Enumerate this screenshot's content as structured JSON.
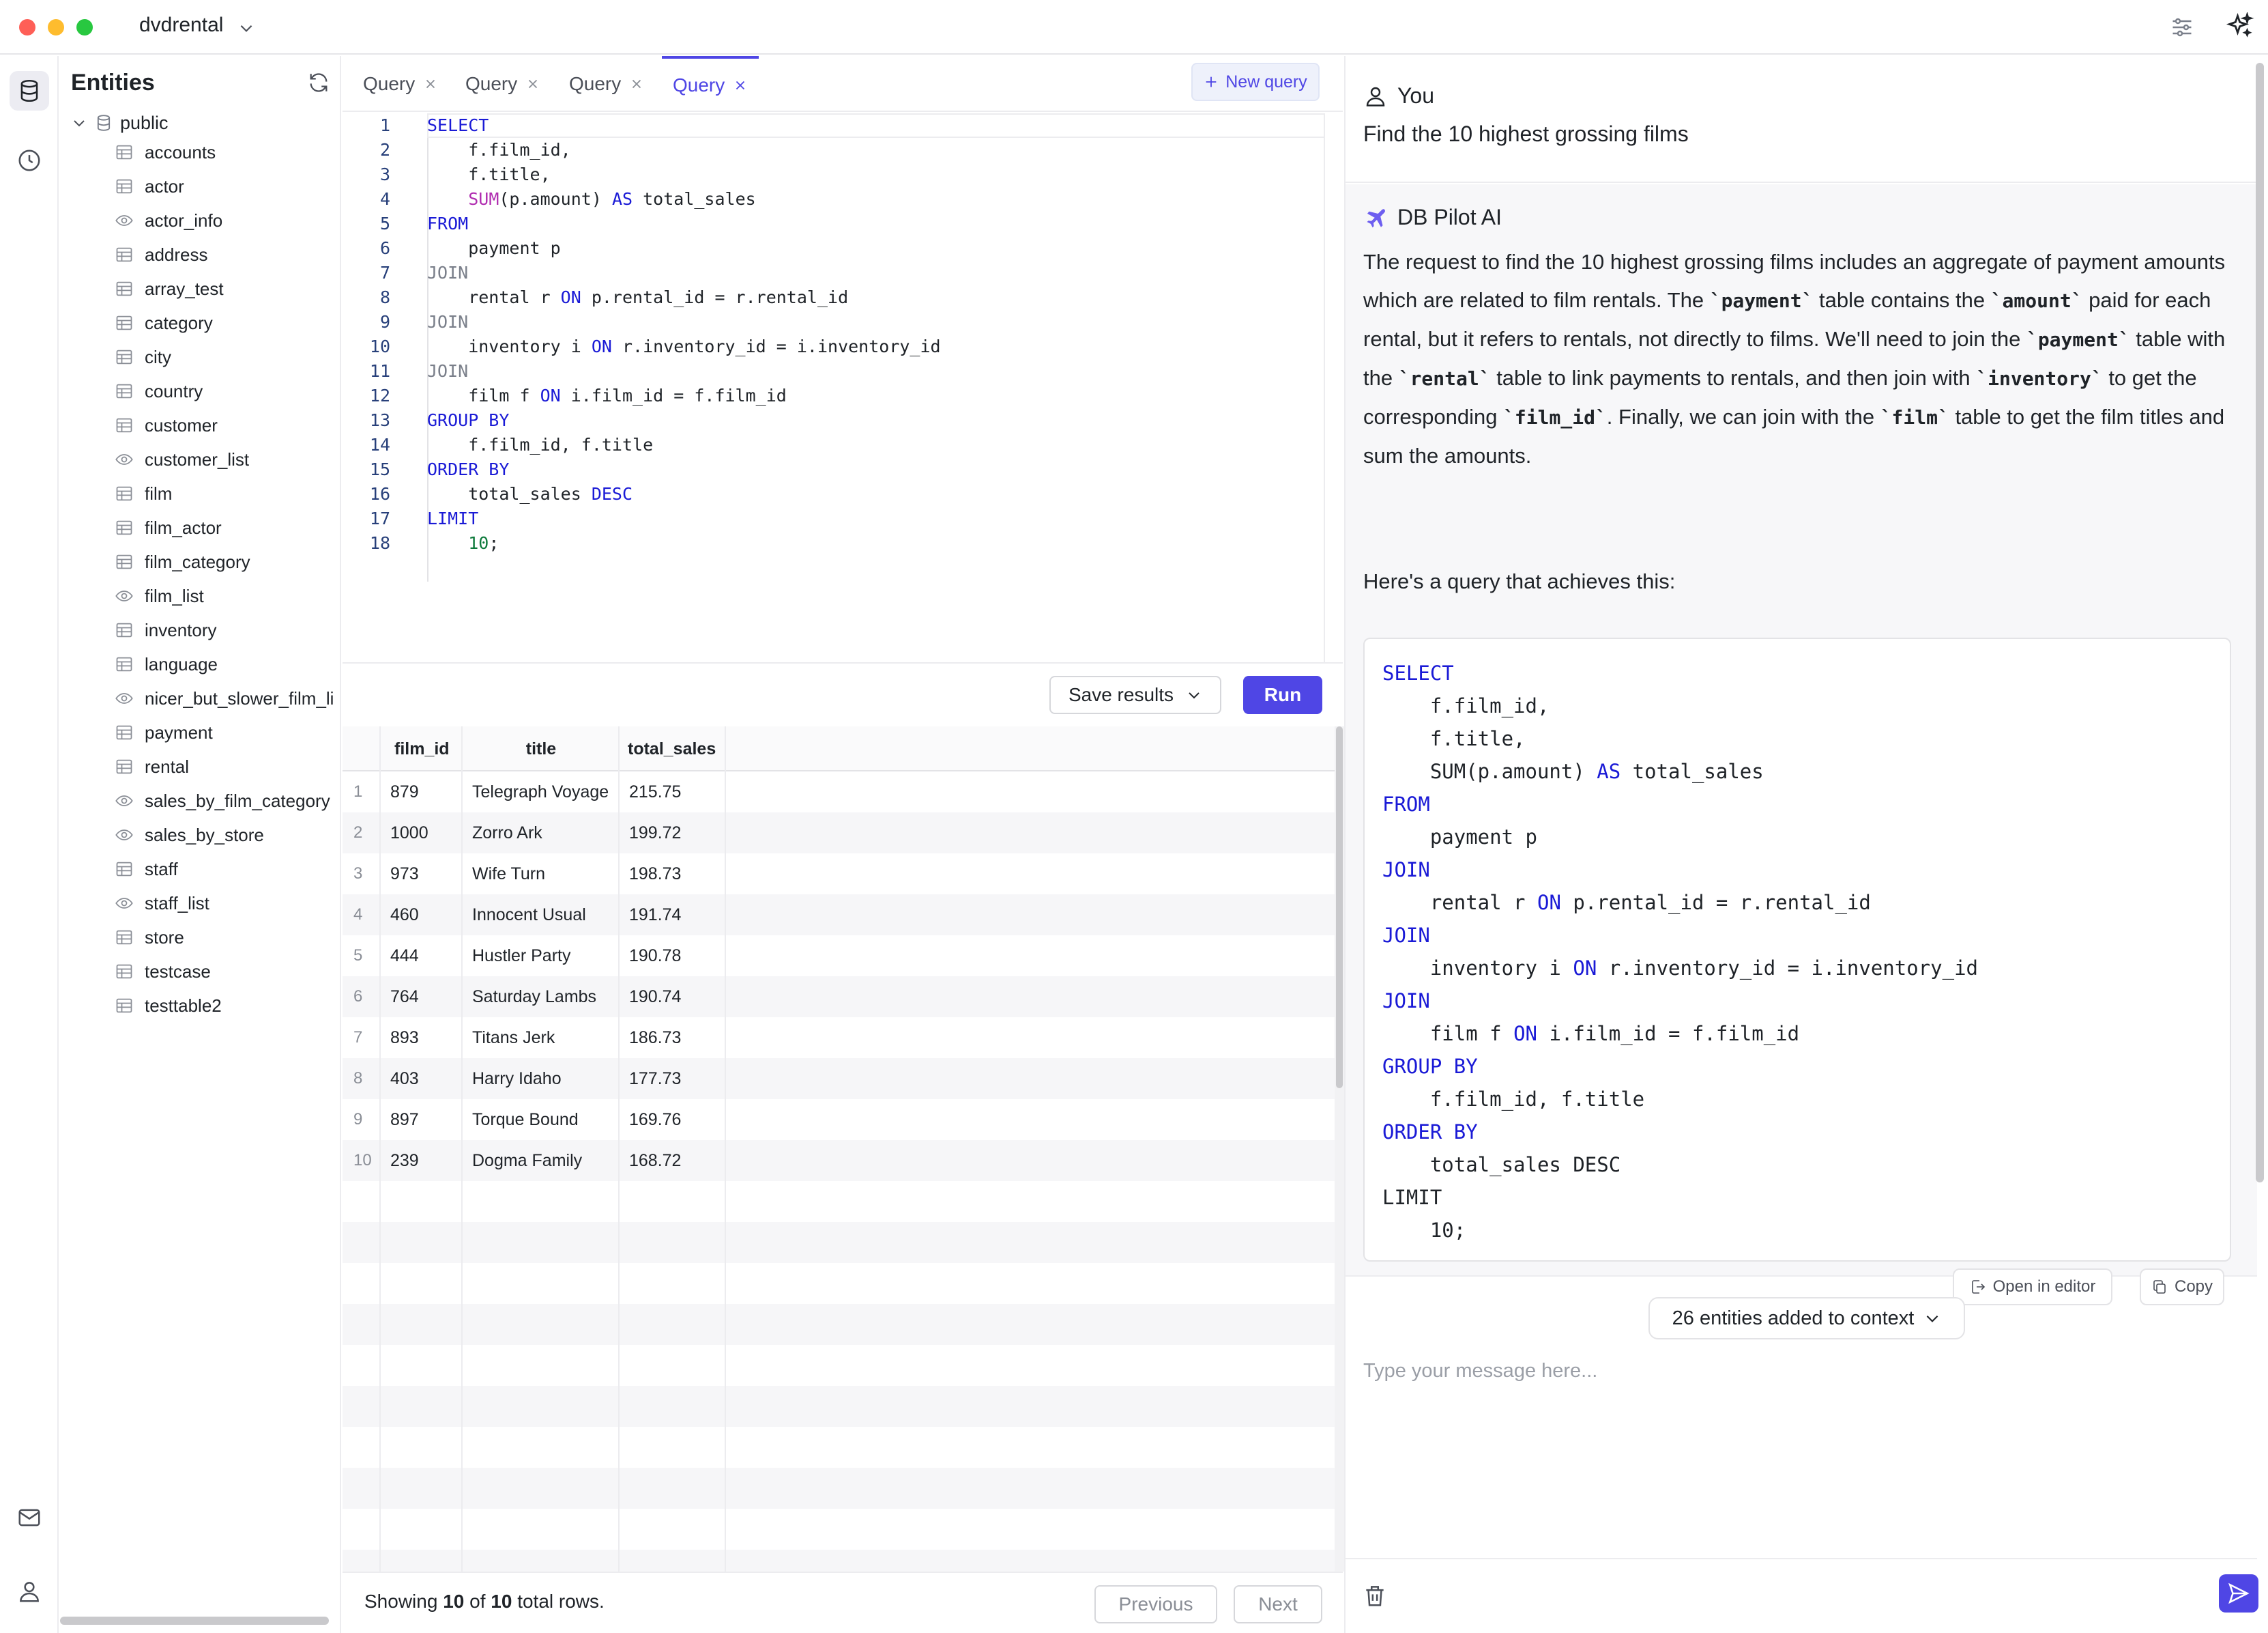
{
  "app": {
    "database_name": "dvdrental",
    "accent_color": "#4f46e5"
  },
  "sidebar": {
    "title": "Entities",
    "schema": "public",
    "entities": [
      {
        "name": "accounts",
        "kind": "table-icon"
      },
      {
        "name": "actor",
        "kind": "table-icon"
      },
      {
        "name": "actor_info",
        "kind": "view-icon"
      },
      {
        "name": "address",
        "kind": "table-icon"
      },
      {
        "name": "array_test",
        "kind": "table-icon"
      },
      {
        "name": "category",
        "kind": "table-icon"
      },
      {
        "name": "city",
        "kind": "table-icon"
      },
      {
        "name": "country",
        "kind": "table-icon"
      },
      {
        "name": "customer",
        "kind": "table-icon"
      },
      {
        "name": "customer_list",
        "kind": "view-icon"
      },
      {
        "name": "film",
        "kind": "table-icon"
      },
      {
        "name": "film_actor",
        "kind": "table-icon"
      },
      {
        "name": "film_category",
        "kind": "table-icon"
      },
      {
        "name": "film_list",
        "kind": "view-icon"
      },
      {
        "name": "inventory",
        "kind": "table-icon"
      },
      {
        "name": "language",
        "kind": "table-icon"
      },
      {
        "name": "nicer_but_slower_film_li",
        "kind": "view-icon"
      },
      {
        "name": "payment",
        "kind": "table-icon"
      },
      {
        "name": "rental",
        "kind": "table-icon"
      },
      {
        "name": "sales_by_film_category",
        "kind": "view-icon"
      },
      {
        "name": "sales_by_store",
        "kind": "view-icon"
      },
      {
        "name": "staff",
        "kind": "table-icon"
      },
      {
        "name": "staff_list",
        "kind": "view-icon"
      },
      {
        "name": "store",
        "kind": "table-icon"
      },
      {
        "name": "testcase",
        "kind": "table-icon"
      },
      {
        "name": "testtable2",
        "kind": "table-icon"
      }
    ]
  },
  "tabs": [
    {
      "label": "Query",
      "active": false
    },
    {
      "label": "Query",
      "active": false
    },
    {
      "label": "Query",
      "active": false
    },
    {
      "label": "Query",
      "active": true
    }
  ],
  "new_query_label": "New query",
  "editor": {
    "line_numbers": [
      "1",
      "2",
      "3",
      "4",
      "5",
      "6",
      "7",
      "8",
      "9",
      "10",
      "11",
      "12",
      "13",
      "14",
      "15",
      "16",
      "17",
      "18"
    ],
    "lines": [
      [
        {
          "t": "SELECT",
          "c": "kw"
        }
      ],
      [
        {
          "t": "    f.film_id,",
          "c": ""
        }
      ],
      [
        {
          "t": "    f.title,",
          "c": ""
        }
      ],
      [
        {
          "t": "    ",
          "c": ""
        },
        {
          "t": "SUM",
          "c": "fn"
        },
        {
          "t": "(p.amount) ",
          "c": ""
        },
        {
          "t": "AS",
          "c": "kw"
        },
        {
          "t": " total_sales",
          "c": ""
        }
      ],
      [
        {
          "t": "FROM",
          "c": "kw"
        }
      ],
      [
        {
          "t": "    payment p",
          "c": ""
        }
      ],
      [
        {
          "t": "JOIN",
          "c": "kw2"
        }
      ],
      [
        {
          "t": "    rental r ",
          "c": ""
        },
        {
          "t": "ON",
          "c": "kw"
        },
        {
          "t": " p.rental_id = r.rental_id",
          "c": ""
        }
      ],
      [
        {
          "t": "JOIN",
          "c": "kw2"
        }
      ],
      [
        {
          "t": "    inventory i ",
          "c": ""
        },
        {
          "t": "ON",
          "c": "kw"
        },
        {
          "t": " r.inventory_id = i.inventory_id",
          "c": ""
        }
      ],
      [
        {
          "t": "JOIN",
          "c": "kw2"
        }
      ],
      [
        {
          "t": "    film f ",
          "c": ""
        },
        {
          "t": "ON",
          "c": "kw"
        },
        {
          "t": " i.film_id = f.film_id",
          "c": ""
        }
      ],
      [
        {
          "t": "GROUP BY",
          "c": "kw"
        }
      ],
      [
        {
          "t": "    f.film_id, f.title",
          "c": ""
        }
      ],
      [
        {
          "t": "ORDER BY",
          "c": "kw"
        }
      ],
      [
        {
          "t": "    total_sales ",
          "c": ""
        },
        {
          "t": "DESC",
          "c": "kw"
        }
      ],
      [
        {
          "t": "LIMIT",
          "c": "kw"
        }
      ],
      [
        {
          "t": "    ",
          "c": ""
        },
        {
          "t": "10",
          "c": "num"
        },
        {
          "t": ";",
          "c": ""
        }
      ]
    ]
  },
  "toolbar": {
    "save_results_label": "Save results",
    "run_label": "Run"
  },
  "results": {
    "columns": [
      "film_id",
      "title",
      "total_sales"
    ],
    "rows": [
      {
        "index": "1",
        "film_id": "879",
        "title": "Telegraph Voyage",
        "total_sales": "215.75"
      },
      {
        "index": "2",
        "film_id": "1000",
        "title": "Zorro Ark",
        "total_sales": "199.72"
      },
      {
        "index": "3",
        "film_id": "973",
        "title": "Wife Turn",
        "total_sales": "198.73"
      },
      {
        "index": "4",
        "film_id": "460",
        "title": "Innocent Usual",
        "total_sales": "191.74"
      },
      {
        "index": "5",
        "film_id": "444",
        "title": "Hustler Party",
        "total_sales": "190.78"
      },
      {
        "index": "6",
        "film_id": "764",
        "title": "Saturday Lambs",
        "total_sales": "190.74"
      },
      {
        "index": "7",
        "film_id": "893",
        "title": "Titans Jerk",
        "total_sales": "186.73"
      },
      {
        "index": "8",
        "film_id": "403",
        "title": "Harry Idaho",
        "total_sales": "177.73"
      },
      {
        "index": "9",
        "film_id": "897",
        "title": "Torque Bound",
        "total_sales": "169.76"
      },
      {
        "index": "10",
        "film_id": "239",
        "title": "Dogma Family",
        "total_sales": "168.72"
      }
    ],
    "status": {
      "prefix": "Showing ",
      "shown": "10",
      "middle": " of ",
      "total": "10",
      "suffix": " total rows."
    },
    "previous_label": "Previous",
    "next_label": "Next"
  },
  "chat": {
    "user_name": "You",
    "user_message": "Find the 10 highest grossing films",
    "ai_name": "DB Pilot AI",
    "ai_paragraph": [
      {
        "t": "The request to find the 10 highest grossing films includes an aggregate of payment amounts which are related to film rentals. The ",
        "code": false
      },
      {
        "t": "`payment`",
        "code": true
      },
      {
        "t": " table contains the ",
        "code": false
      },
      {
        "t": "`amount`",
        "code": true
      },
      {
        "t": " paid for each rental, but it refers to rentals, not directly to films. We'll need to join the ",
        "code": false
      },
      {
        "t": "`payment`",
        "code": true
      },
      {
        "t": " table with the ",
        "code": false
      },
      {
        "t": "`rental`",
        "code": true
      },
      {
        "t": " table to link payments to rentals, and then join with ",
        "code": false
      },
      {
        "t": "`inventory`",
        "code": true
      },
      {
        "t": " to get the corresponding ",
        "code": false
      },
      {
        "t": "`film_id`",
        "code": true
      },
      {
        "t": ". Finally, we can join with the ",
        "code": false
      },
      {
        "t": "`film`",
        "code": true
      },
      {
        "t": " table to get the film titles and sum the amounts.",
        "code": false
      }
    ],
    "ai_intro": "Here's a query that achieves this:",
    "ai_code_lines": [
      [
        {
          "t": "SELECT",
          "c": "akw"
        }
      ],
      [
        {
          "t": "    f.film_id,",
          "c": ""
        }
      ],
      [
        {
          "t": "    f.title,",
          "c": ""
        }
      ],
      [
        {
          "t": "    SUM(p.amount) ",
          "c": ""
        },
        {
          "t": "AS",
          "c": "akw"
        },
        {
          "t": " total_sales",
          "c": ""
        }
      ],
      [
        {
          "t": "FROM",
          "c": "akw"
        }
      ],
      [
        {
          "t": "    payment p",
          "c": ""
        }
      ],
      [
        {
          "t": "JOIN",
          "c": "akw"
        }
      ],
      [
        {
          "t": "    rental r ",
          "c": ""
        },
        {
          "t": "ON",
          "c": "akw"
        },
        {
          "t": " p.rental_id = r.rental_id",
          "c": ""
        }
      ],
      [
        {
          "t": "JOIN",
          "c": "akw"
        }
      ],
      [
        {
          "t": "    inventory i ",
          "c": ""
        },
        {
          "t": "ON",
          "c": "akw"
        },
        {
          "t": " r.inventory_id = i.inventory_id",
          "c": ""
        }
      ],
      [
        {
          "t": "JOIN",
          "c": "akw"
        }
      ],
      [
        {
          "t": "    film f ",
          "c": ""
        },
        {
          "t": "ON",
          "c": "akw"
        },
        {
          "t": " i.film_id = f.film_id",
          "c": ""
        }
      ],
      [
        {
          "t": "GROUP BY",
          "c": "akw"
        }
      ],
      [
        {
          "t": "    f.film_id, f.title",
          "c": ""
        }
      ],
      [
        {
          "t": "ORDER BY",
          "c": "akw"
        }
      ],
      [
        {
          "t": "    total_sales DESC",
          "c": ""
        }
      ],
      [
        {
          "t": "LIMIT",
          "c": ""
        }
      ],
      [
        {
          "t": "    10;",
          "c": ""
        }
      ]
    ],
    "open_in_editor_label": "Open in editor",
    "copy_label": "Copy",
    "context_label": "26 entities added to context",
    "input_placeholder": "Type your message here..."
  }
}
